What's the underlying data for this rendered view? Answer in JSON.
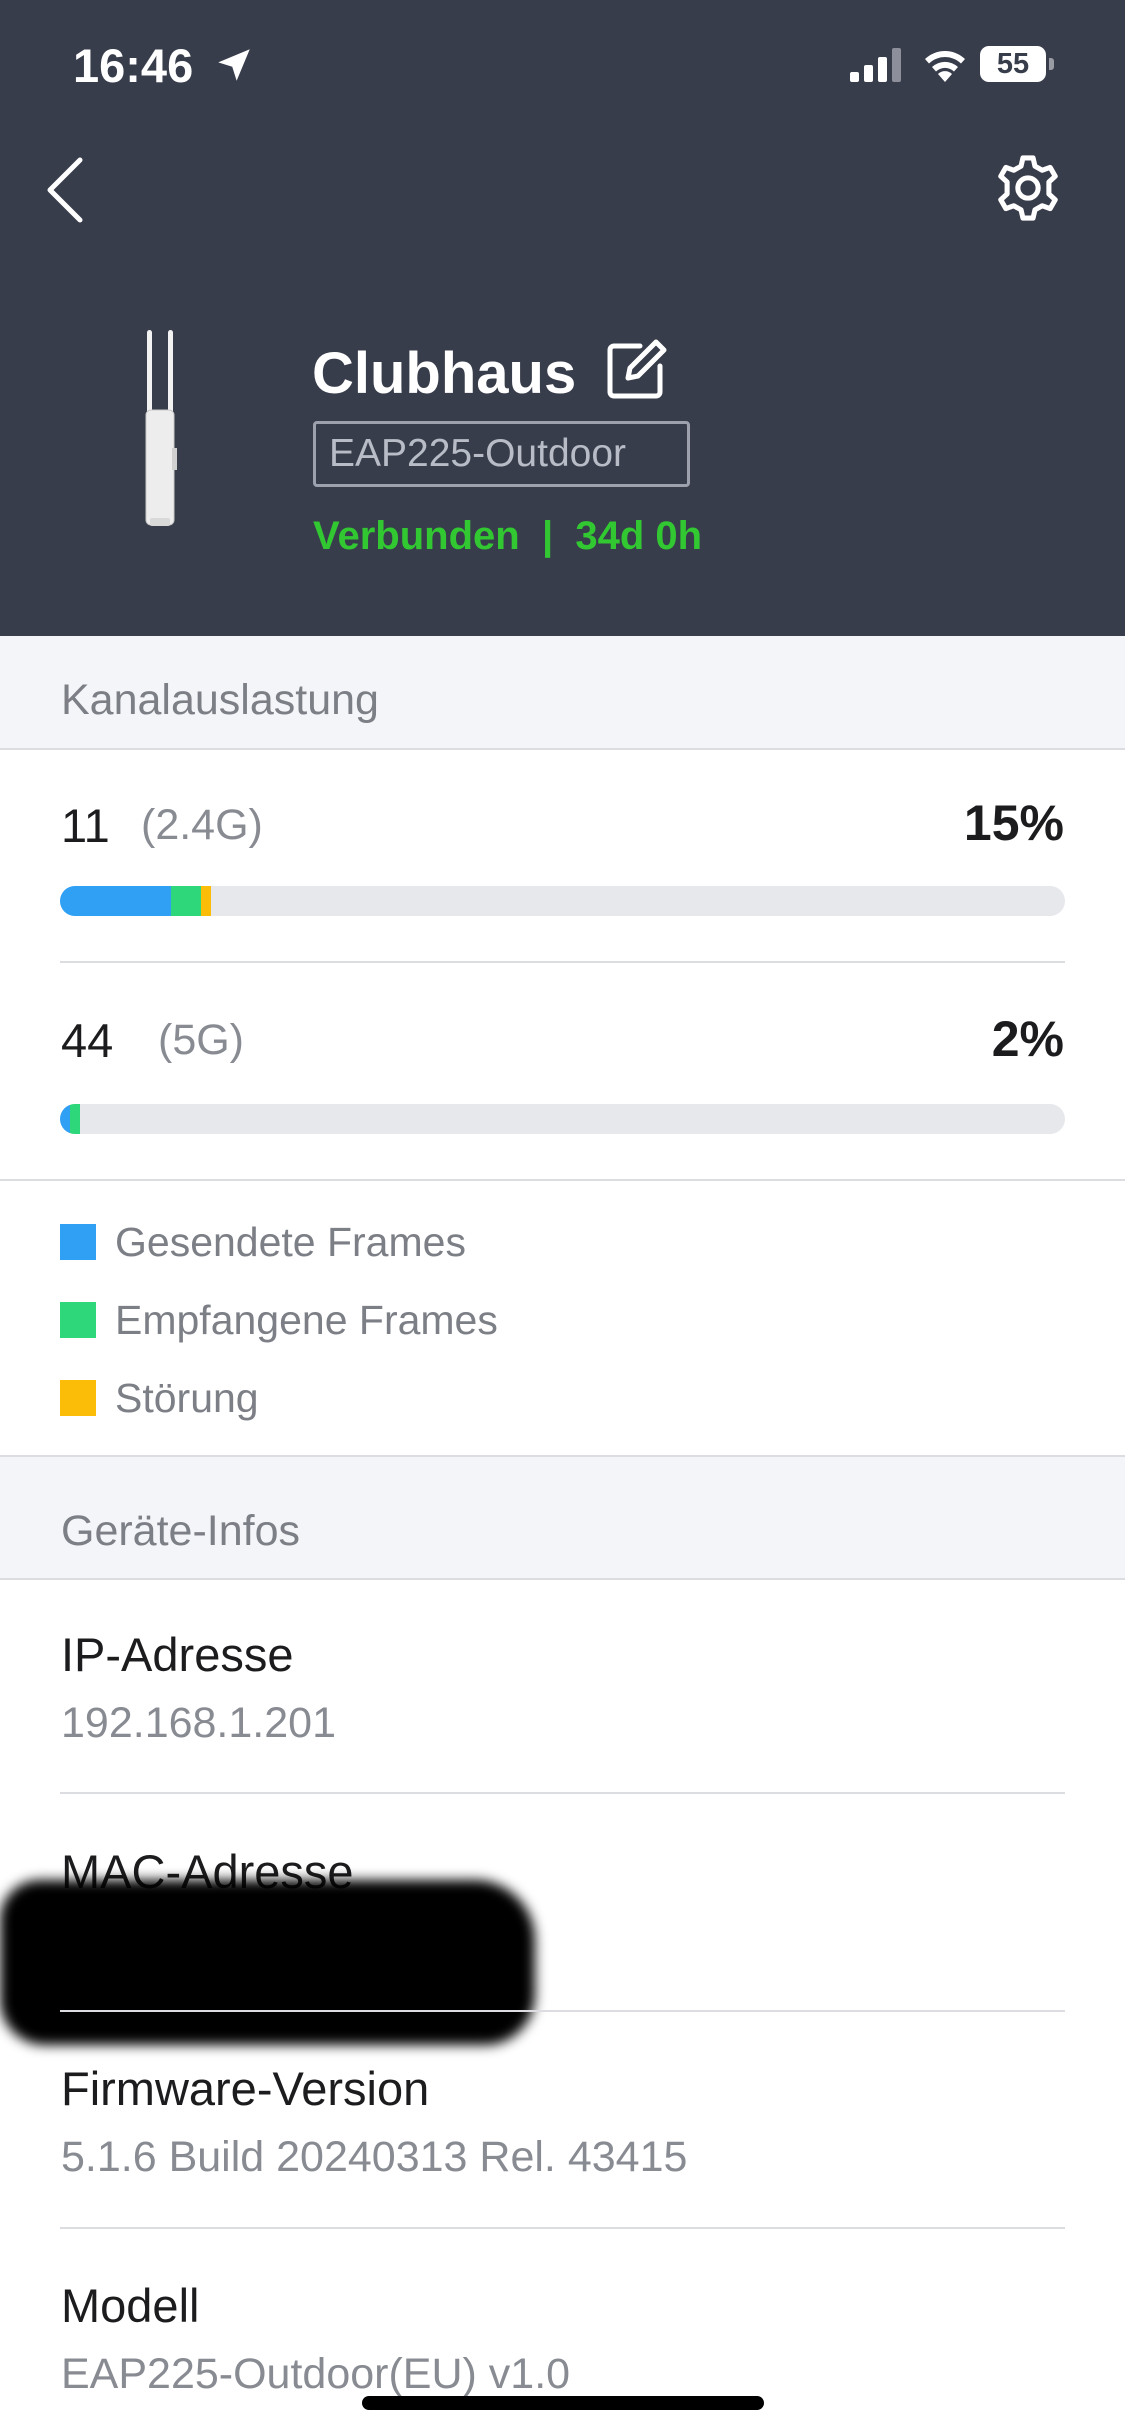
{
  "status_bar": {
    "time": "16:46",
    "battery": "55"
  },
  "device": {
    "name": "Clubhaus",
    "model_badge": "EAP225-Outdoor",
    "status": "Verbunden",
    "separator": "|",
    "uptime": "34d 0h",
    "status_color": "#32c832"
  },
  "channel_section": {
    "title": "Kanalauslastung",
    "channels": [
      {
        "channel": "11",
        "band": "(2.4G)",
        "percent": "15%",
        "sent_pct": 11,
        "received_pct": 3,
        "interference_pct": 1
      },
      {
        "channel": "44",
        "band": "(5G)",
        "percent": "2%",
        "sent_pct": 1,
        "received_pct": 1,
        "interference_pct": 0
      }
    ],
    "legend": [
      {
        "label": "Gesendete Frames",
        "color": "#30a0f5"
      },
      {
        "label": "Empfangene Frames",
        "color": "#2ed87a"
      },
      {
        "label": "Störung",
        "color": "#fbbd07"
      }
    ]
  },
  "info_section": {
    "title": "Geräte-Infos",
    "rows": [
      {
        "label": "IP-Adresse",
        "value": "192.168.1.201"
      },
      {
        "label": "MAC-Adresse",
        "value": ""
      },
      {
        "label": "Firmware-Version",
        "value": "5.1.6 Build 20240313 Rel. 43415"
      },
      {
        "label": "Modell",
        "value": "EAP225-Outdoor(EU) v1.0"
      }
    ]
  },
  "colors": {
    "header_bg": "#383d4b",
    "sent": "#30a0f5",
    "received": "#2ed87a",
    "interference": "#fbbd07"
  }
}
